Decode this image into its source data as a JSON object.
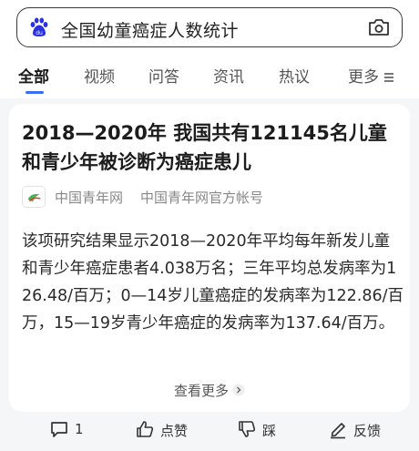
{
  "search": {
    "query": "全国幼童癌症人数统计",
    "logo_icon": "baidu-paw-icon",
    "camera_icon": "camera-icon"
  },
  "tabs": [
    {
      "label": "全部",
      "active": true
    },
    {
      "label": "视频"
    },
    {
      "label": "问答"
    },
    {
      "label": "资讯"
    },
    {
      "label": "热议"
    },
    {
      "label": "更多"
    }
  ],
  "result": {
    "title": "2018—2020年 我国共有121145名儿童和青少年被诊断为癌症患儿",
    "source_name": "中国青年网",
    "source_account": "中国青年网官方帐号",
    "summary": "该项研究结果显示2018—2020年平均每年新发儿童和青少年癌症患者4.038万名；三年平均总发病率为126.48/百万；0—14岁儿童癌症的发病率为122.86/百万，15—19岁青少年癌症的发病率为137.64/百万。",
    "see_more": "查看更多"
  },
  "actions": {
    "comment_count": "1",
    "like": "点赞",
    "dislike": "踩",
    "feedback": "反馈"
  },
  "colors": {
    "accent": "#3a6cf4",
    "baidu_blue": "#2932e1"
  }
}
